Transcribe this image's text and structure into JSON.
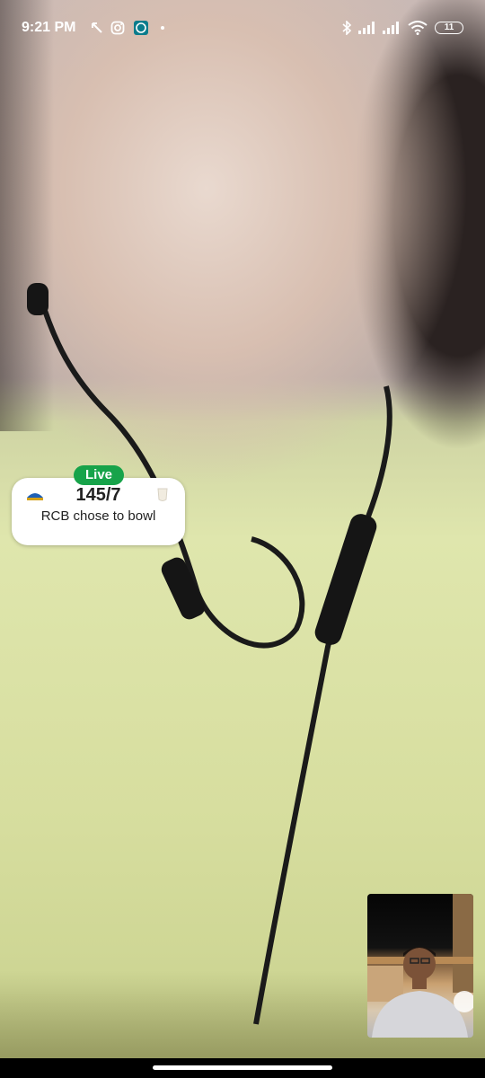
{
  "status_bar": {
    "time": "9:21 PM",
    "left_icons": [
      "missed-call-icon",
      "instagram-icon",
      "whatsapp-icon",
      "dot-icon"
    ],
    "right_icons": [
      "bluetooth-icon",
      "signal-icon",
      "signal-icon",
      "wifi-icon"
    ],
    "battery": "11"
  },
  "score_card": {
    "badge": "Live",
    "score": "145/7",
    "status": "RCB chose to bowl"
  },
  "colors": {
    "live_badge": "#17a34a",
    "card_background": "#ffffff"
  }
}
